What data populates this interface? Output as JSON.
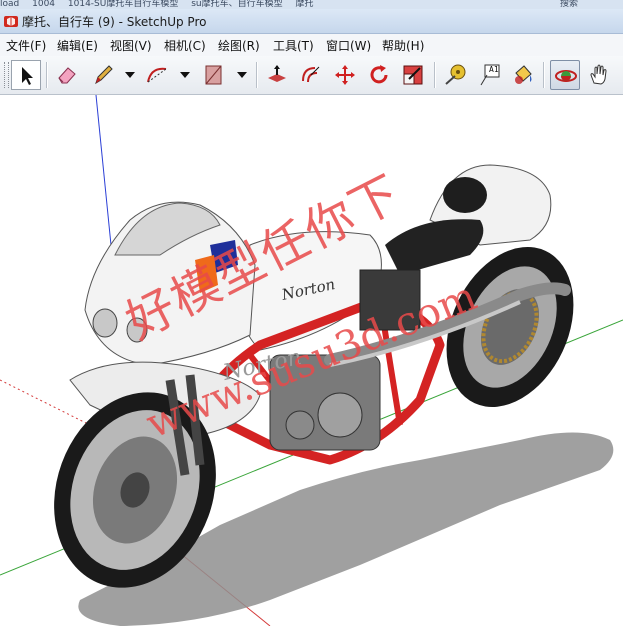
{
  "background_breadcrumb": [
    "load",
    "1004",
    "1014-SU摩托车自行车模型",
    "su摩托车、自行车模型",
    "摩托",
    "搜索"
  ],
  "window": {
    "title": "摩托、自行车 (9) - SketchUp Pro",
    "app_icon": "sketchup-logo-icon"
  },
  "menu": {
    "items": [
      "文件(F)",
      "编辑(E)",
      "视图(V)",
      "相机(C)",
      "绘图(R)",
      "工具(T)",
      "窗口(W)",
      "帮助(H)"
    ]
  },
  "toolbar": {
    "tools": [
      {
        "name": "select-tool",
        "icon": "arrow-pointer-icon",
        "active": false
      },
      {
        "name": "eraser-tool",
        "icon": "eraser-icon",
        "active": false
      },
      {
        "name": "line-tool",
        "icon": "pencil-icon",
        "active": false,
        "dropdown": true
      },
      {
        "name": "arc-tool",
        "icon": "arc-icon",
        "active": false,
        "dropdown": true
      },
      {
        "name": "rectangle-tool",
        "icon": "rectangle-icon",
        "active": false,
        "dropdown": true
      },
      {
        "name": "push-pull-tool",
        "icon": "push-pull-icon",
        "active": false
      },
      {
        "name": "offset-tool",
        "icon": "offset-icon",
        "active": false
      },
      {
        "name": "move-tool",
        "icon": "move-arrows-icon",
        "active": false
      },
      {
        "name": "rotate-tool",
        "icon": "rotate-icon",
        "active": false
      },
      {
        "name": "scale-tool",
        "icon": "scale-icon",
        "active": false
      },
      {
        "name": "tape-measure-tool",
        "icon": "tape-measure-icon",
        "active": false
      },
      {
        "name": "text-tool",
        "icon": "text-label-icon",
        "label": "A1",
        "active": false
      },
      {
        "name": "paint-bucket-tool",
        "icon": "paint-bucket-icon",
        "active": false
      },
      {
        "name": "orbit-tool",
        "icon": "orbit-icon",
        "active": true
      },
      {
        "name": "pan-tool",
        "icon": "hand-icon",
        "active": false
      }
    ]
  },
  "viewport": {
    "model": "motorcycle",
    "tank_logo_1": "Norton",
    "tank_logo_2": "Norton",
    "watermark_cn": "好模型任你下",
    "watermark_url": "www.susu3d.com",
    "colors": {
      "axis_red": "#d43a3a",
      "axis_green": "#3aa53a",
      "axis_blue": "#2b3fd6",
      "frame": "#d42323",
      "shadow": "#8f8f8f"
    }
  }
}
